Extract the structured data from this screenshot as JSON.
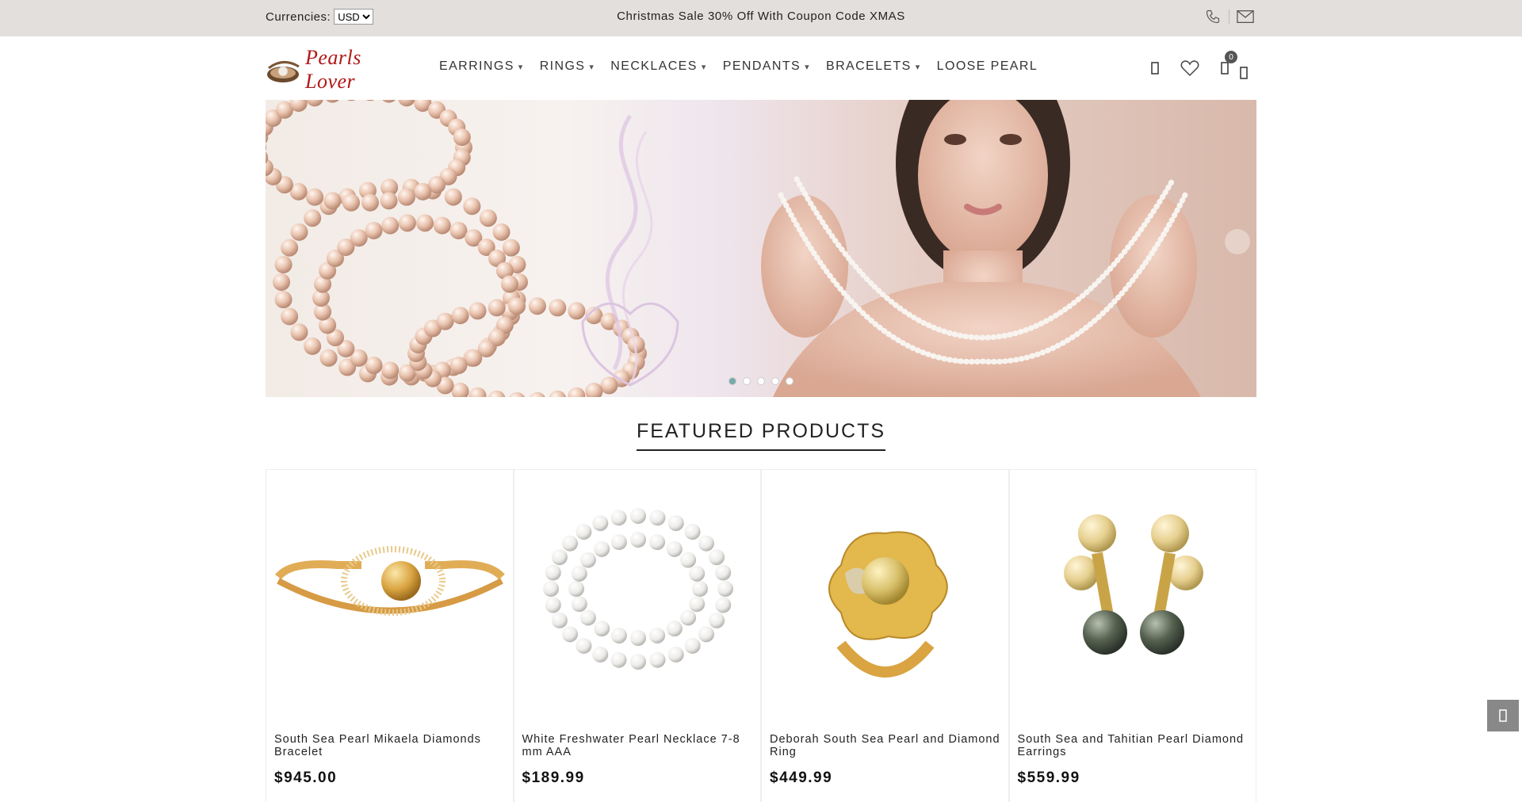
{
  "topbar": {
    "currency_label": "Currencies:",
    "currency_value": "USD",
    "currency_options": [
      "USD"
    ],
    "promo": "Christmas Sale 30% Off With Coupon Code XMAS",
    "phone_icon": "phone-icon",
    "mail_icon": "mail-icon"
  },
  "header": {
    "logo_text": "Pearls Lover",
    "nav": [
      {
        "label": "EARRINGS",
        "dropdown": true
      },
      {
        "label": "RINGS",
        "dropdown": true
      },
      {
        "label": "NECKLACES",
        "dropdown": true
      },
      {
        "label": "PENDANTS",
        "dropdown": true
      },
      {
        "label": "BRACELETS",
        "dropdown": true
      },
      {
        "label": "LOOSE PEARL",
        "dropdown": false
      }
    ],
    "cart_count": "0",
    "caret": "▾"
  },
  "banner": {
    "slides": 5,
    "active_slide": 0
  },
  "featured": {
    "title": "FEATURED PRODUCTS",
    "products": [
      {
        "name": "South Sea Pearl Mikaela Diamonds Bracelet",
        "price": "$945.00"
      },
      {
        "name": "White Freshwater Pearl Necklace 7-8 mm AAA",
        "price": "$189.99"
      },
      {
        "name": "Deborah South Sea Pearl and Diamond Ring",
        "price": "$449.99"
      },
      {
        "name": "South Sea and Tahitian Pearl Diamond Earrings",
        "price": "$559.99"
      }
    ]
  },
  "colors": {
    "topbar_bg": "#e3dfdd",
    "logo_red": "#b01818",
    "gold": "#d9a441",
    "backtop_bg": "#888888"
  }
}
